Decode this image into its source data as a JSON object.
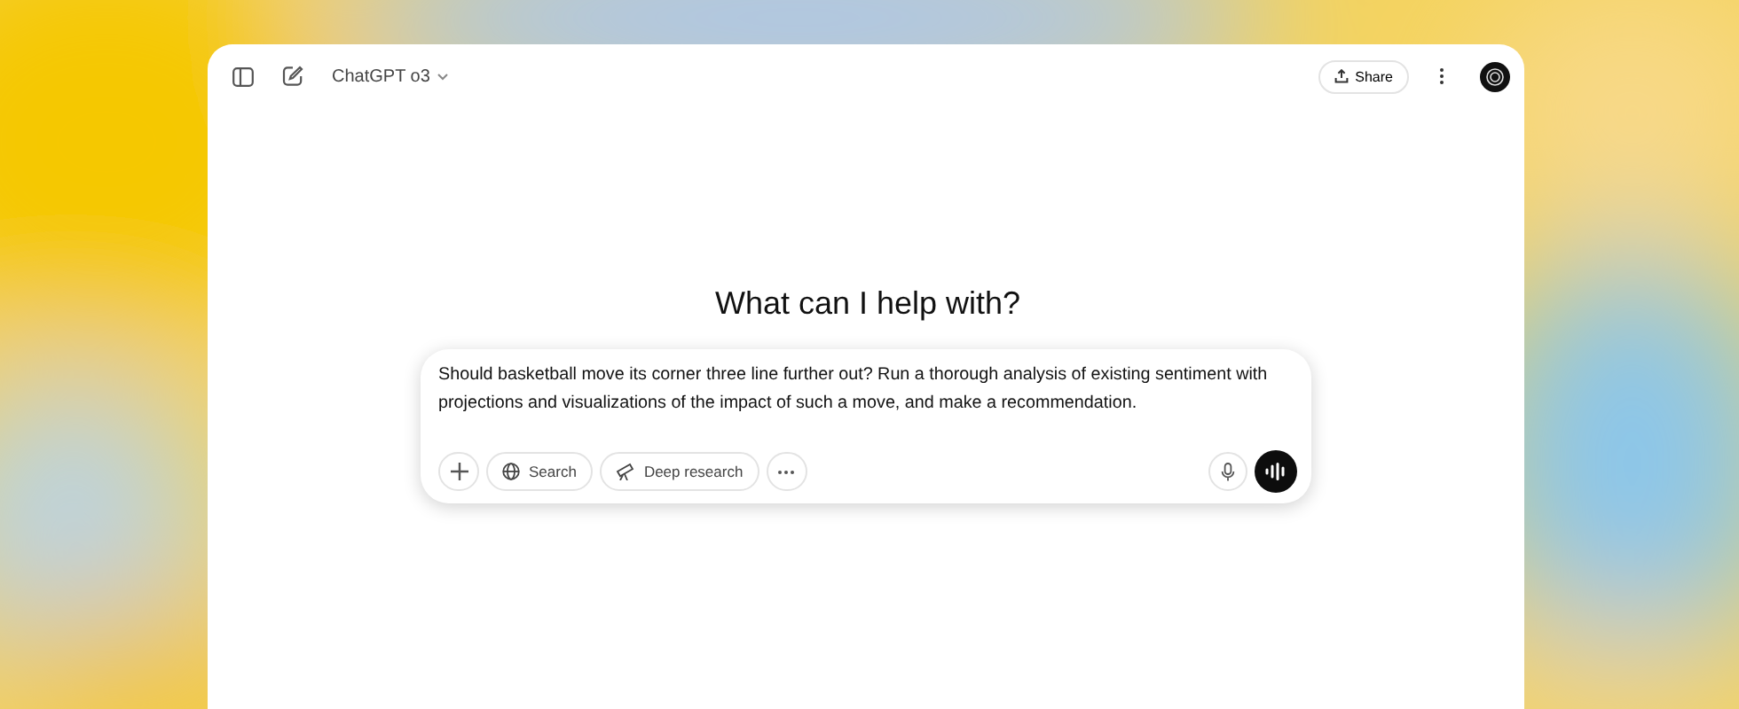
{
  "header": {
    "model": "ChatGPT o3",
    "share": "Share"
  },
  "heading": "What can I help with?",
  "composer": {
    "value": "Should basketball move its corner three line further out? Run a thorough analysis of existing sentiment with projections and visualizations of the impact of such a move, and make a recommendation.",
    "tools": [
      {
        "kind": "plus"
      },
      {
        "kind": "search",
        "label": "Search"
      },
      {
        "kind": "research",
        "label": "Deep research"
      },
      {
        "kind": "more"
      }
    ]
  }
}
